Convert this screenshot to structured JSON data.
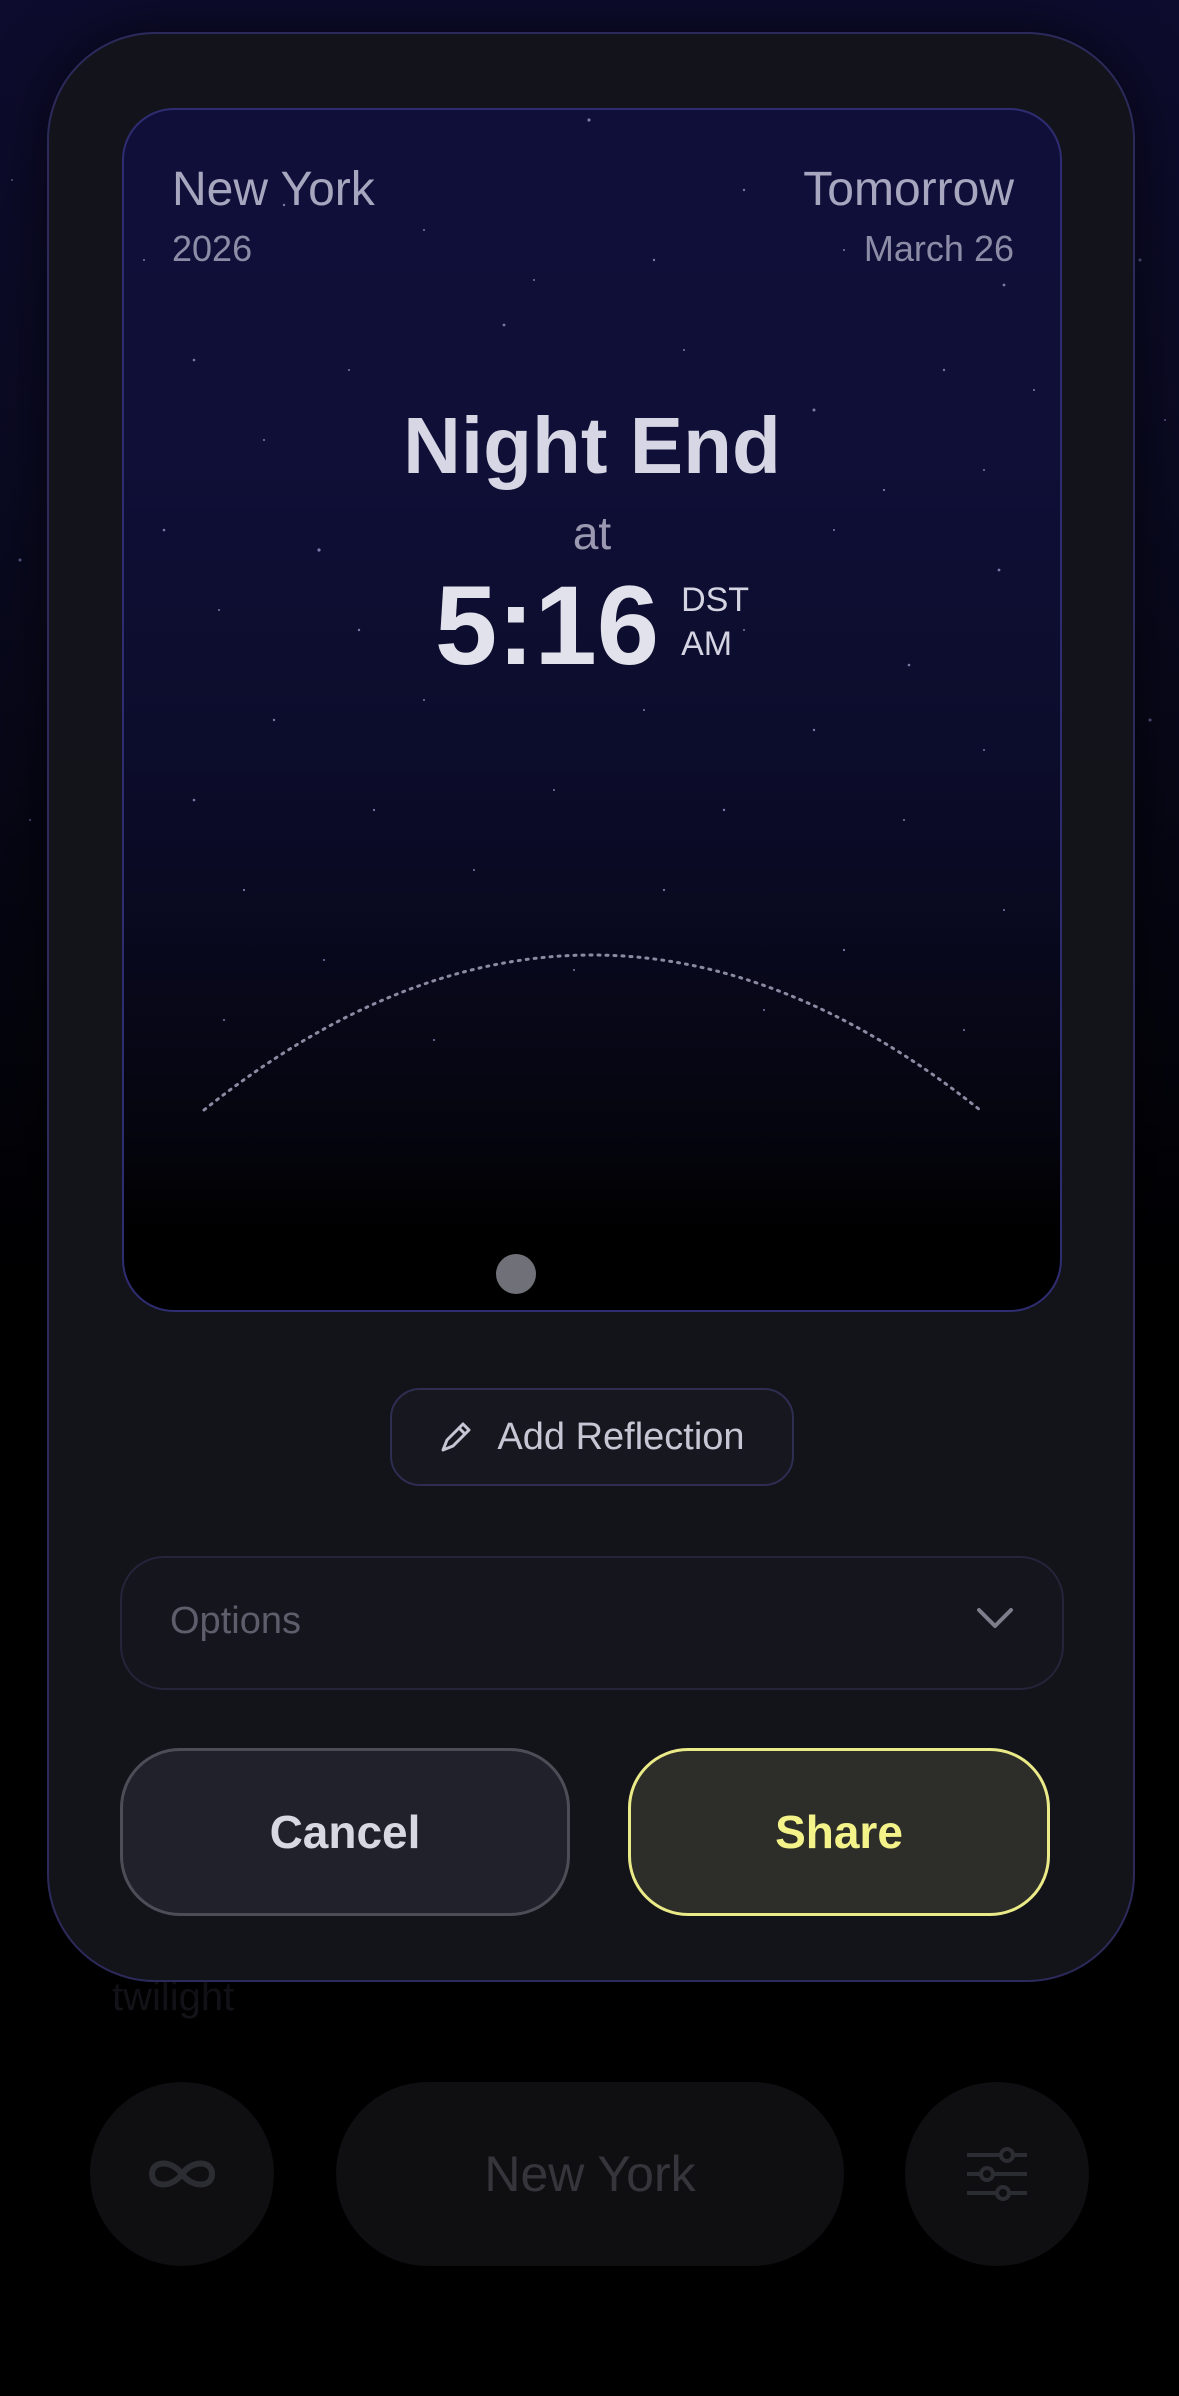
{
  "background": {
    "hint_left": "twilight",
    "hint_right": "...",
    "city_pill": "New York",
    "loop_icon": "infinity-icon",
    "settings_icon": "sliders-icon"
  },
  "modal": {
    "card": {
      "city": "New York",
      "year": "2026",
      "when": "Tomorrow",
      "date": "March 26",
      "event": "Night End",
      "at_label": "at",
      "time": "5:16",
      "tz": "DST",
      "ampm": "AM"
    },
    "add_reflection": {
      "label": "Add Reflection",
      "icon": "pencil-icon"
    },
    "options": {
      "label": "Options",
      "icon": "chevron-down-icon"
    },
    "actions": {
      "cancel": "Cancel",
      "share": "Share"
    }
  },
  "colors": {
    "share_accent": "#f3f38a",
    "card_border": "#2f2d72"
  }
}
